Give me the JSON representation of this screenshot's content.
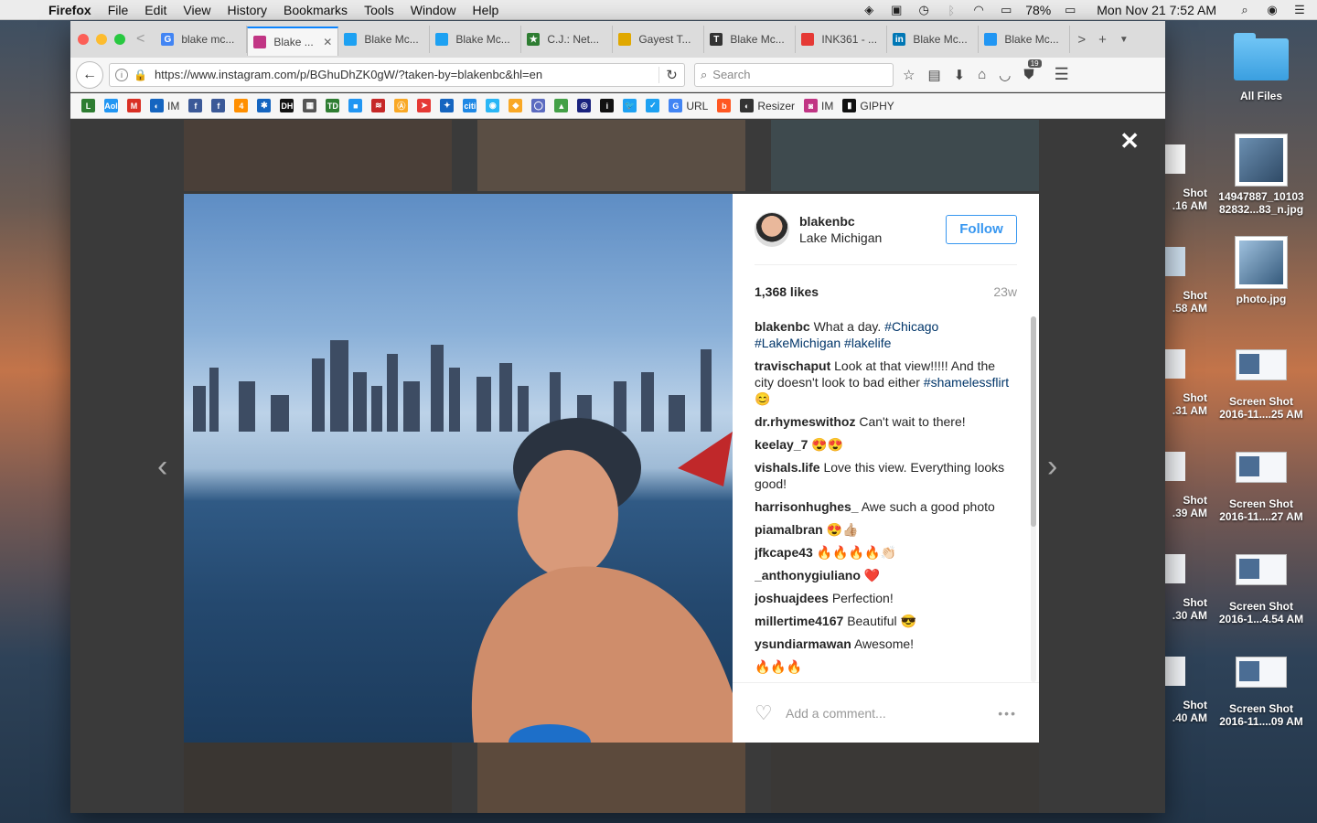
{
  "menubar": {
    "app": "Firefox",
    "items": [
      "File",
      "Edit",
      "View",
      "History",
      "Bookmarks",
      "Tools",
      "Window",
      "Help"
    ],
    "battery": "78%",
    "clock": "Mon Nov 21  7:52 AM"
  },
  "desktop": {
    "folder_label": "All Files",
    "files": [
      {
        "line1": "14947887_10103",
        "line2": "82832...83_n.jpg"
      },
      {
        "line1": "photo.jpg",
        "line2": ""
      },
      {
        "line1": "Screen Shot",
        "line2": "2016-11....25 AM"
      },
      {
        "line1": "Screen Shot",
        "line2": "2016-11....27 AM"
      },
      {
        "line1": "Screen Shot",
        "line2": "2016-1...4.54 AM"
      },
      {
        "line1": "Screen Shot",
        "line2": "2016-11....09 AM"
      }
    ],
    "partial_files": [
      {
        "line1": "Shot",
        "line2": ".16 AM"
      },
      {
        "line1": "Shot",
        "line2": ".58 AM"
      },
      {
        "line1": "Shot",
        "line2": ".31 AM"
      },
      {
        "line1": "Shot",
        "line2": ".39 AM"
      },
      {
        "line1": "Shot",
        "line2": ".30 AM"
      },
      {
        "line1": "Shot",
        "line2": ".40 AM"
      }
    ]
  },
  "tabs": [
    {
      "label": "blake mc...",
      "fav": "G",
      "color": "#4285f4"
    },
    {
      "label": "Blake ...",
      "fav": "",
      "color": "#c13584"
    },
    {
      "label": "Blake Mc...",
      "fav": "",
      "color": "#1da1f2"
    },
    {
      "label": "Blake Mc...",
      "fav": "",
      "color": "#1da1f2"
    },
    {
      "label": "C.J.: Net...",
      "fav": "★",
      "color": "#2e7d32"
    },
    {
      "label": "Gayest T...",
      "fav": "",
      "color": "#e0a800"
    },
    {
      "label": "Blake Mc...",
      "fav": "T",
      "color": "#333333"
    },
    {
      "label": "INK361 - ...",
      "fav": "",
      "color": "#e53935"
    },
    {
      "label": "Blake Mc...",
      "fav": "in",
      "color": "#0077b5"
    },
    {
      "label": "Blake Mc...",
      "fav": "",
      "color": "#2196f3"
    }
  ],
  "navbar": {
    "url": "https://www.instagram.com/p/BGhuDhZK0gW/?taken-by=blakenbc&hl=en",
    "search_placeholder": "Search",
    "badge_count": "19"
  },
  "bookmarks": [
    {
      "label": "",
      "ic": "L",
      "color": "#2e7d32"
    },
    {
      "label": "",
      "ic": "Aol",
      "color": "#2196f3"
    },
    {
      "label": "",
      "ic": "M",
      "color": "#d93025"
    },
    {
      "label": "IM",
      "ic": "◐",
      "color": "#1565c0"
    },
    {
      "label": "",
      "ic": "f",
      "color": "#3b5998"
    },
    {
      "label": "",
      "ic": "f",
      "color": "#3b5998"
    },
    {
      "label": "",
      "ic": "4",
      "color": "#ff8f00"
    },
    {
      "label": "",
      "ic": "✱",
      "color": "#1565c0"
    },
    {
      "label": "",
      "ic": "DH",
      "color": "#111111"
    },
    {
      "label": "",
      "ic": "▦",
      "color": "#555555"
    },
    {
      "label": "",
      "ic": "TD",
      "color": "#2e7d32"
    },
    {
      "label": "",
      "ic": "■",
      "color": "#2196f3"
    },
    {
      "label": "",
      "ic": "≋",
      "color": "#c62828"
    },
    {
      "label": "",
      "ic": "Ⓐ",
      "color": "#f9a825"
    },
    {
      "label": "",
      "ic": "➤",
      "color": "#e53935"
    },
    {
      "label": "",
      "ic": "✦",
      "color": "#1565c0"
    },
    {
      "label": "",
      "ic": "citi",
      "color": "#1e88e5"
    },
    {
      "label": "",
      "ic": "◉",
      "color": "#29b6f6"
    },
    {
      "label": "",
      "ic": "◆",
      "color": "#f9a825"
    },
    {
      "label": "",
      "ic": "◯",
      "color": "#5c6bc0"
    },
    {
      "label": "",
      "ic": "▲",
      "color": "#43a047"
    },
    {
      "label": "",
      "ic": "◎",
      "color": "#1a237e"
    },
    {
      "label": "",
      "ic": "i",
      "color": "#111111"
    },
    {
      "label": "",
      "ic": "🐦",
      "color": "#1da1f2"
    },
    {
      "label": "",
      "ic": "✓",
      "color": "#1da1f2"
    },
    {
      "label": "URL",
      "ic": "G",
      "color": "#4285f4"
    },
    {
      "label": "",
      "ic": "b",
      "color": "#ff5722"
    },
    {
      "label": "Resizer",
      "ic": "◐",
      "color": "#333333"
    },
    {
      "label": "IM",
      "ic": "◙",
      "color": "#c13584"
    },
    {
      "label": "GIPHY",
      "ic": "▮",
      "color": "#111111"
    }
  ],
  "post": {
    "username": "blakenbc",
    "location": "Lake Michigan",
    "follow_label": "Follow",
    "likes": "1,368 likes",
    "age": "23w",
    "add_comment_placeholder": "Add a comment...",
    "more_label": "•••",
    "comments": [
      {
        "author": "blakenbc",
        "text": "What a day.",
        "tags": "#Chicago #LakeMichigan #lakelife"
      },
      {
        "author": "travischaput",
        "text": "Look at that view!!!!! And the city doesn't look to bad either",
        "tags": "#shamelessflirt 😊"
      },
      {
        "author": "dr.rhymeswithoz",
        "text": "Can't wait to there!",
        "tags": ""
      },
      {
        "author": "keelay_7",
        "text": "😍😍",
        "tags": ""
      },
      {
        "author": "vishals.life",
        "text": "Love this view. Everything looks good!",
        "tags": ""
      },
      {
        "author": "harrisonhughes_",
        "text": "Awe such a good photo",
        "tags": ""
      },
      {
        "author": "piamalbran",
        "text": "😍👍🏼",
        "tags": ""
      },
      {
        "author": "jfkcape43",
        "text": "🔥🔥🔥🔥👏🏻",
        "tags": ""
      },
      {
        "author": "_anthonygiuliano",
        "text": "❤️",
        "tags": ""
      },
      {
        "author": "joshuajdees",
        "text": "Perfection!",
        "tags": ""
      },
      {
        "author": "millertime4167",
        "text": "Beautiful 😎",
        "tags": ""
      },
      {
        "author": "ysundiarmawan",
        "text": "Awesome!",
        "tags": ""
      },
      {
        "author": "",
        "text": "🔥🔥🔥",
        "tags": ""
      }
    ]
  }
}
